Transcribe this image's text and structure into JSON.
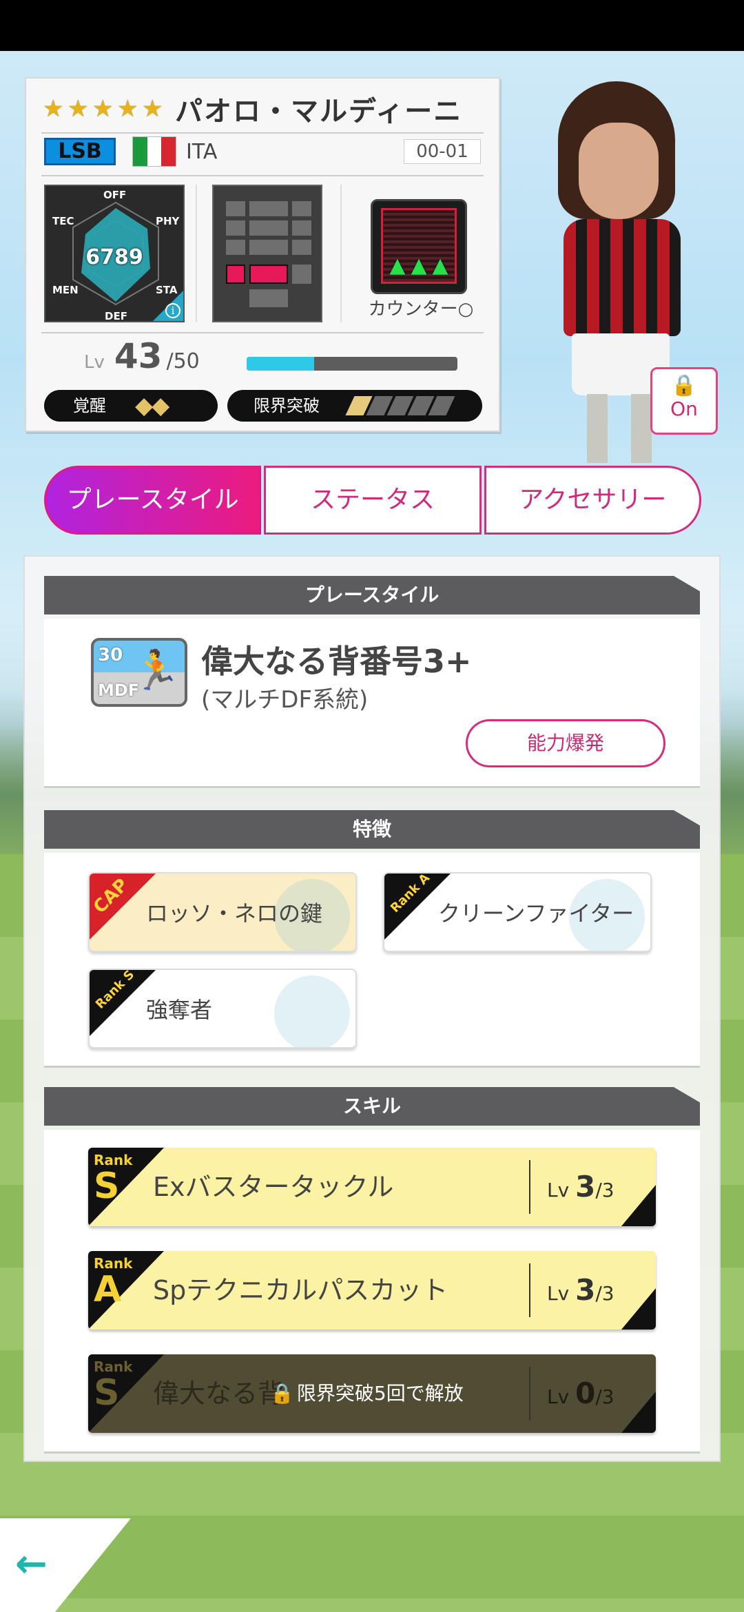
{
  "player": {
    "stars": [
      "★",
      "★",
      "★",
      "★",
      "★"
    ],
    "name": "パオロ・マルディーニ",
    "position": "LSB",
    "nation": "ITA",
    "flag_colors": [
      "#1a9a3d",
      "#ffffff",
      "#d9252f"
    ],
    "card_no": "00-01",
    "radar": {
      "total": "6789",
      "labels": {
        "off": "OFF",
        "phy": "PHY",
        "sta": "STA",
        "def": "DEF",
        "men": "MEN",
        "tec": "TEC"
      }
    },
    "counter_label": "カウンター○",
    "level": {
      "label": "Lv",
      "value": "43",
      "max": "/50",
      "progress": 0.32
    },
    "awaken": {
      "label": "覚醒",
      "marks": "◆◆"
    },
    "limit_break": {
      "label": "限界突破",
      "filled": 1,
      "total": 5
    },
    "lock_toggle": "On"
  },
  "tabs": [
    {
      "label": "プレースタイル",
      "active": true
    },
    {
      "label": "ステータス",
      "active": false
    },
    {
      "label": "アクセサリー",
      "active": false
    }
  ],
  "playstyle": {
    "header": "プレースタイル",
    "icon_top": "30",
    "icon_bottom": "MDF",
    "title": "偉大なる背番号3+",
    "subtitle": "(マルチDF系統)",
    "burst_button": "能力爆発"
  },
  "traits": {
    "header": "特徴",
    "items": [
      {
        "tag": "CAP",
        "label": "ロッソ・ネロの鍵"
      },
      {
        "tag": "Rank A",
        "label": "クリーンファイター"
      },
      {
        "tag": "Rank S",
        "label": "強奪者"
      }
    ]
  },
  "skills": {
    "header": "スキル",
    "items": [
      {
        "rank_label": "Rank",
        "rank": "S",
        "name": "Exバスタータックル",
        "lv_label": "Lv",
        "lv": "3",
        "lv_max": "/3",
        "locked": false
      },
      {
        "rank_label": "Rank",
        "rank": "A",
        "name": "Spテクニカルパスカット",
        "lv_label": "Lv",
        "lv": "3",
        "lv_max": "/3",
        "locked": false
      },
      {
        "rank_label": "Rank",
        "rank": "S",
        "name": "偉大なる背",
        "lv_label": "Lv",
        "lv": "0",
        "lv_max": "/3",
        "locked": true,
        "lock_text": "限界突破5回で解放"
      }
    ]
  },
  "nav": {
    "back_icon": "←"
  }
}
